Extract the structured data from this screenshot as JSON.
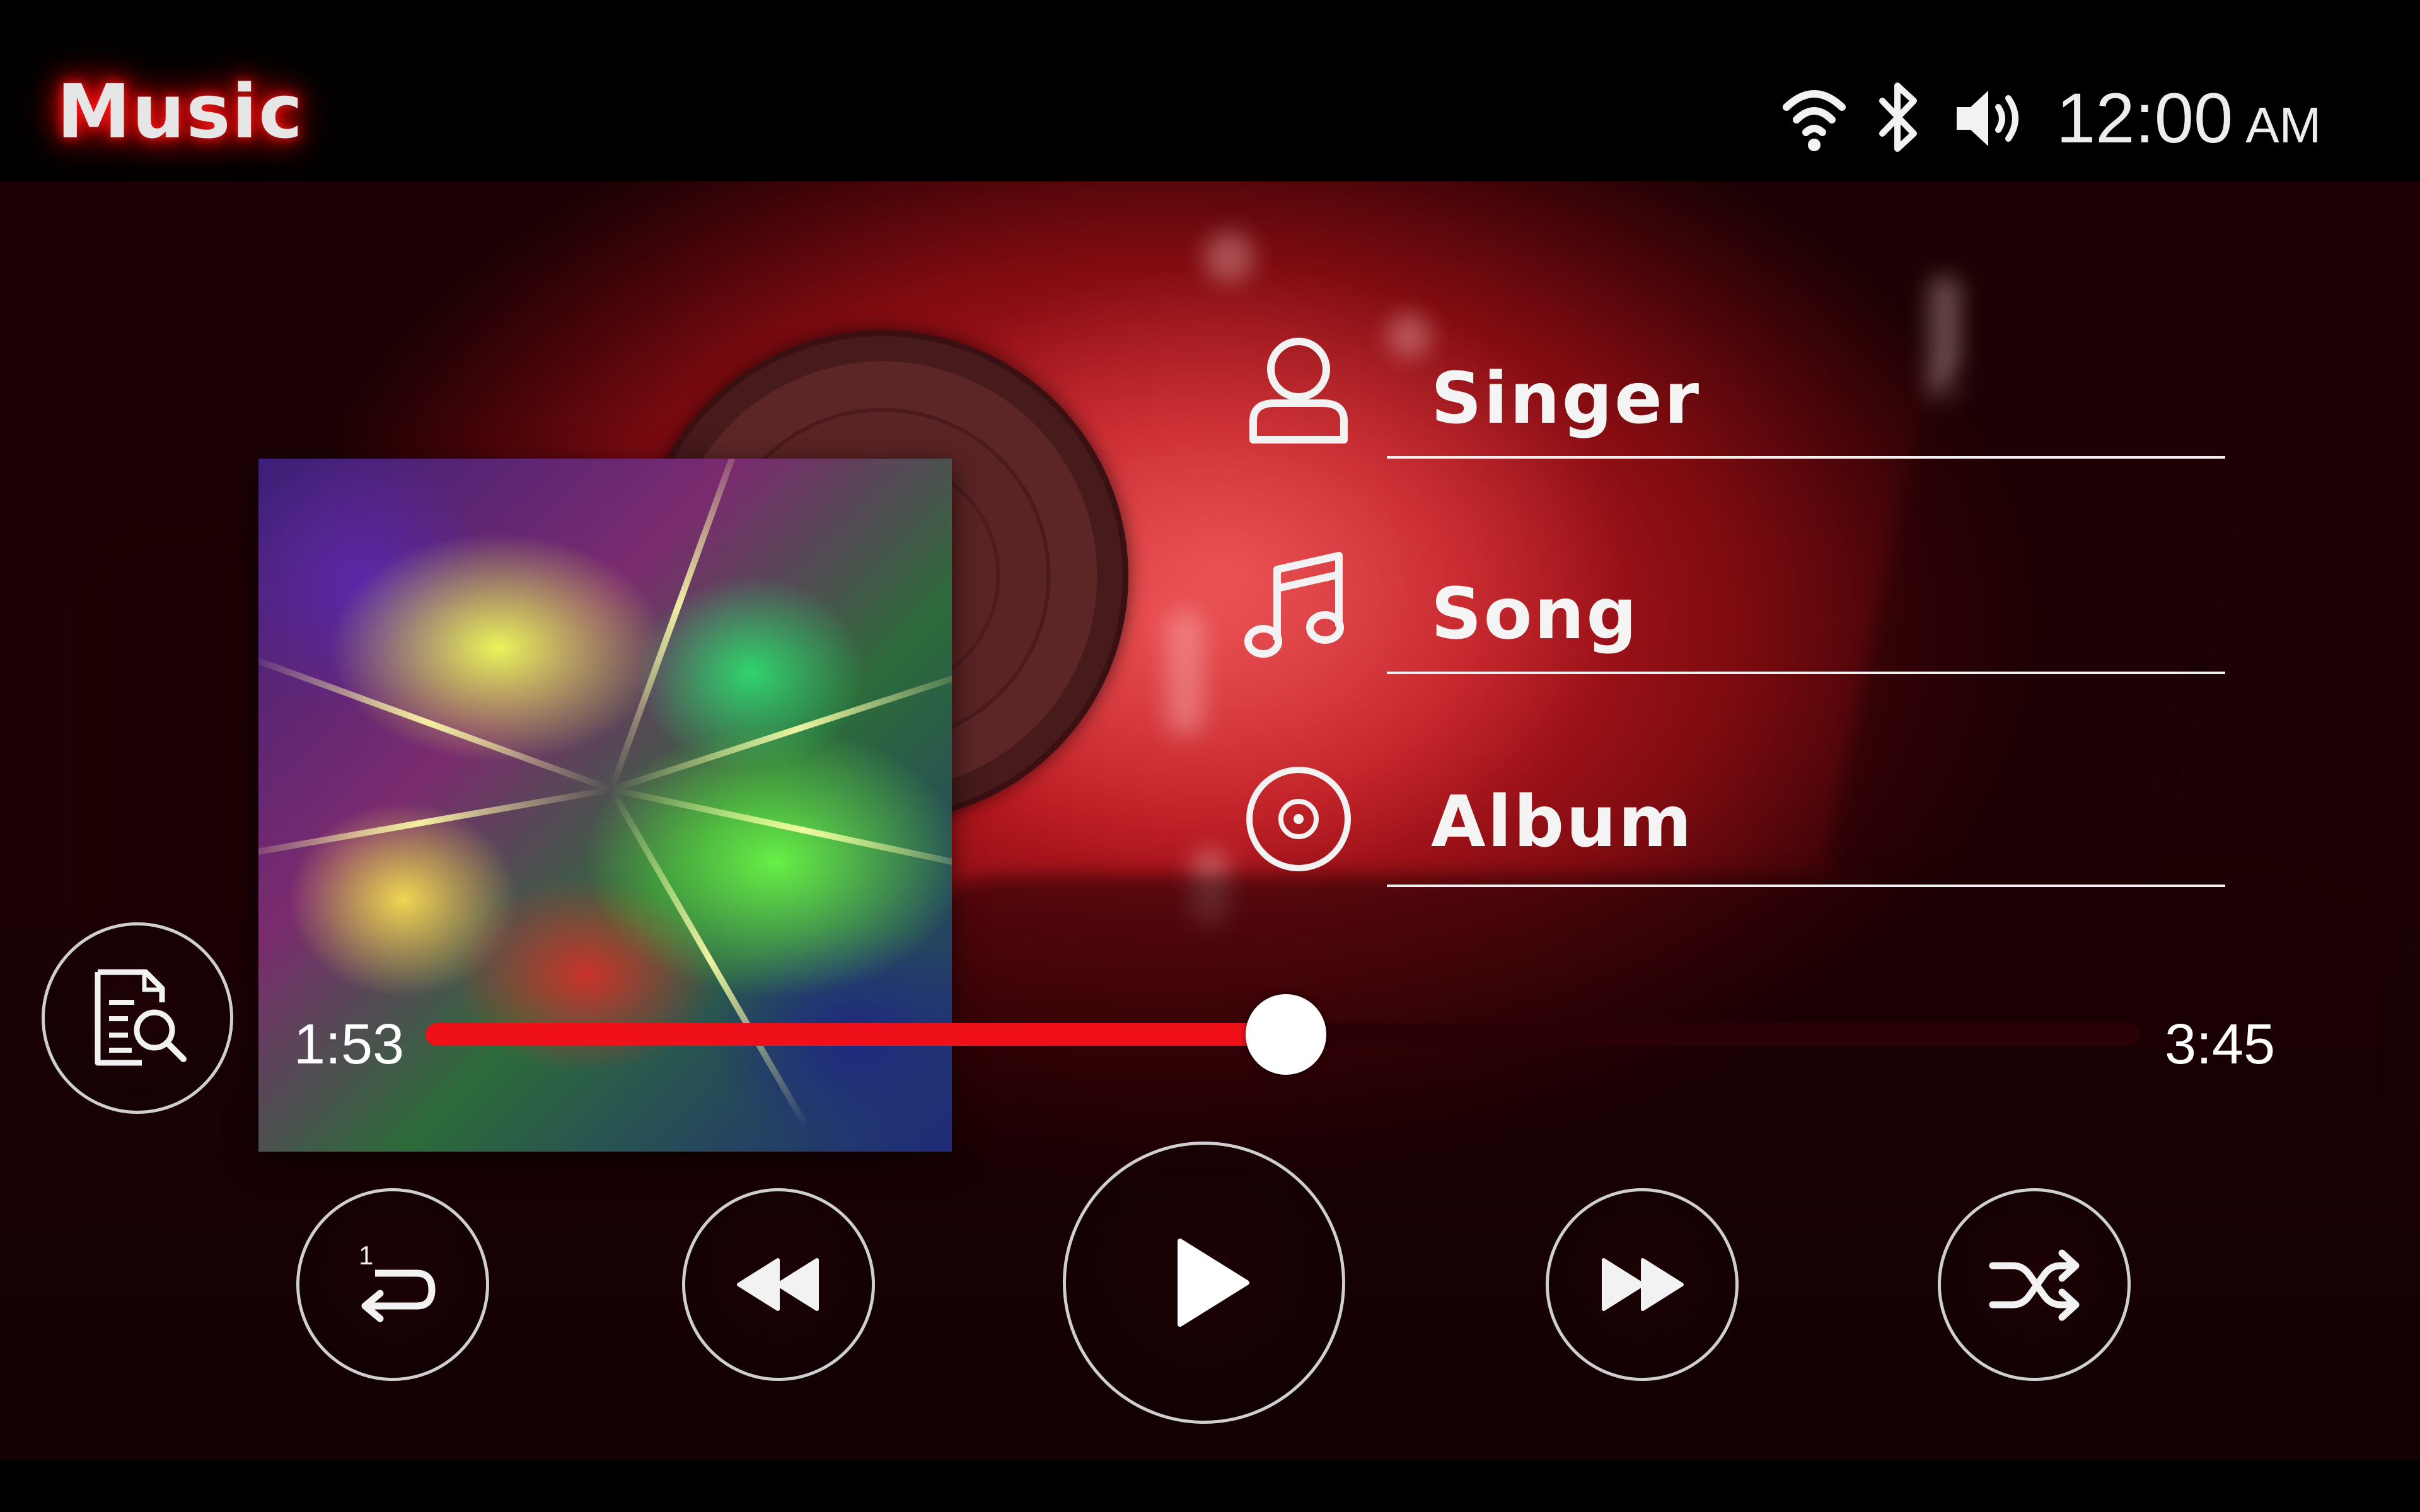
{
  "header": {
    "title": "Music",
    "status": {
      "wifi_icon": "wifi-icon",
      "bluetooth_icon": "bluetooth-icon",
      "volume_icon": "volume-icon",
      "time": "12:00",
      "ampm": "AM"
    }
  },
  "track": {
    "singer": "Singer",
    "song": "Song",
    "album": "Album",
    "singer_icon": "person-icon",
    "song_icon": "music-note-icon",
    "album_icon": "disc-icon",
    "album_art_icon": "album-cover-image",
    "vinyl_icon": "vinyl-record-image"
  },
  "playback": {
    "elapsed": "1:53",
    "duration": "3:45",
    "progress_fraction": 0.502
  },
  "controls": {
    "browse_icon": "file-search-icon",
    "repeat_icon": "repeat-one-icon",
    "repeat_badge": "1",
    "rewind_icon": "rewind-icon",
    "play_icon": "play-icon",
    "fast_forward_icon": "fast-forward-icon",
    "shuffle_icon": "shuffle-icon"
  },
  "colors": {
    "accent": "#f0101a",
    "title_glow": "#ff0000",
    "background_red": "#b8181f"
  }
}
